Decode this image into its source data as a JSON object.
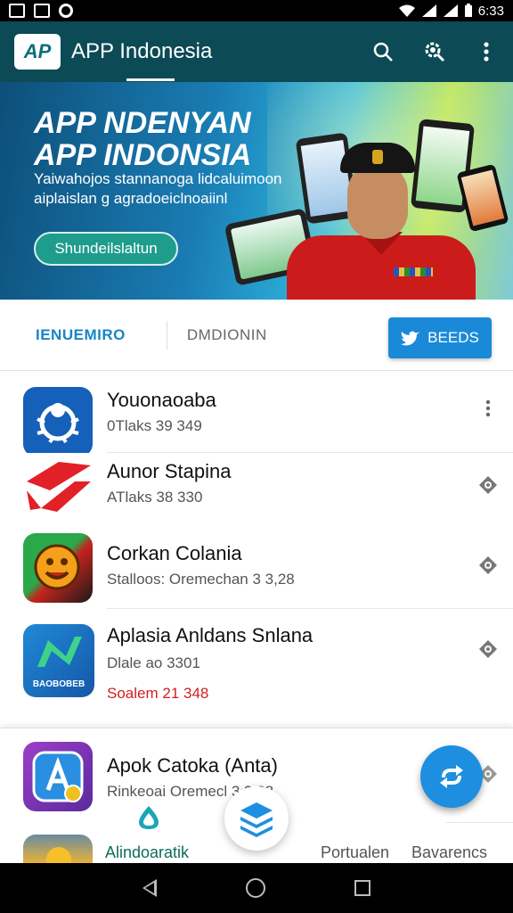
{
  "status_bar": {
    "time": "6:33"
  },
  "app_bar": {
    "logo_text": "AP",
    "title": "APP Indonesia",
    "actions": [
      "search-icon",
      "settings-search-icon",
      "more-vert-icon"
    ]
  },
  "banner": {
    "headline_1": "APP NDENYAN",
    "headline_2": "APP INDONSIA",
    "subtitle_1": "Yaiwahojos stannanoga lidcaluimoon",
    "subtitle_2": "aiplaislan g agradoeiclnoaiinl",
    "cta_label": "Shundeilslaltun"
  },
  "tabs": {
    "tab1": "IENUEMIRO",
    "tab2": "DMDIONIN",
    "filter_label": "BEEDS"
  },
  "apps": [
    {
      "name": "Youonaoaba",
      "meta": "0Tlaks 39 349",
      "extra": "",
      "action": "more-vert-icon"
    },
    {
      "name": "Aunor Stapina",
      "meta": "ATlaks 38 330",
      "extra": "",
      "action": "eye-icon"
    },
    {
      "name": "Corkan Colania",
      "meta": "Stalloos: Oremechan 3 3,28",
      "extra": "",
      "action": "eye-icon"
    },
    {
      "name": "Aplasia Anldans Snlana",
      "meta": "Dlale ao 3301",
      "extra": "Soalem 21 348",
      "action": "eye-icon",
      "icon_label": "BAOBOBEB"
    },
    {
      "name": "Apok Catoka (Anta)",
      "meta": "Rinkeoai Oremecl 3 3,38",
      "extra": "",
      "action": "eye-icon"
    }
  ],
  "bottom_nav": {
    "items": [
      "Alindoaratik",
      "Portualen",
      "Bavarencs"
    ],
    "active_index": 0
  },
  "colors": {
    "app_bar": "#0c4a56",
    "accent": "#1a8ad8",
    "active_tab": "#1784c6",
    "warning_text": "#d11f1f"
  }
}
